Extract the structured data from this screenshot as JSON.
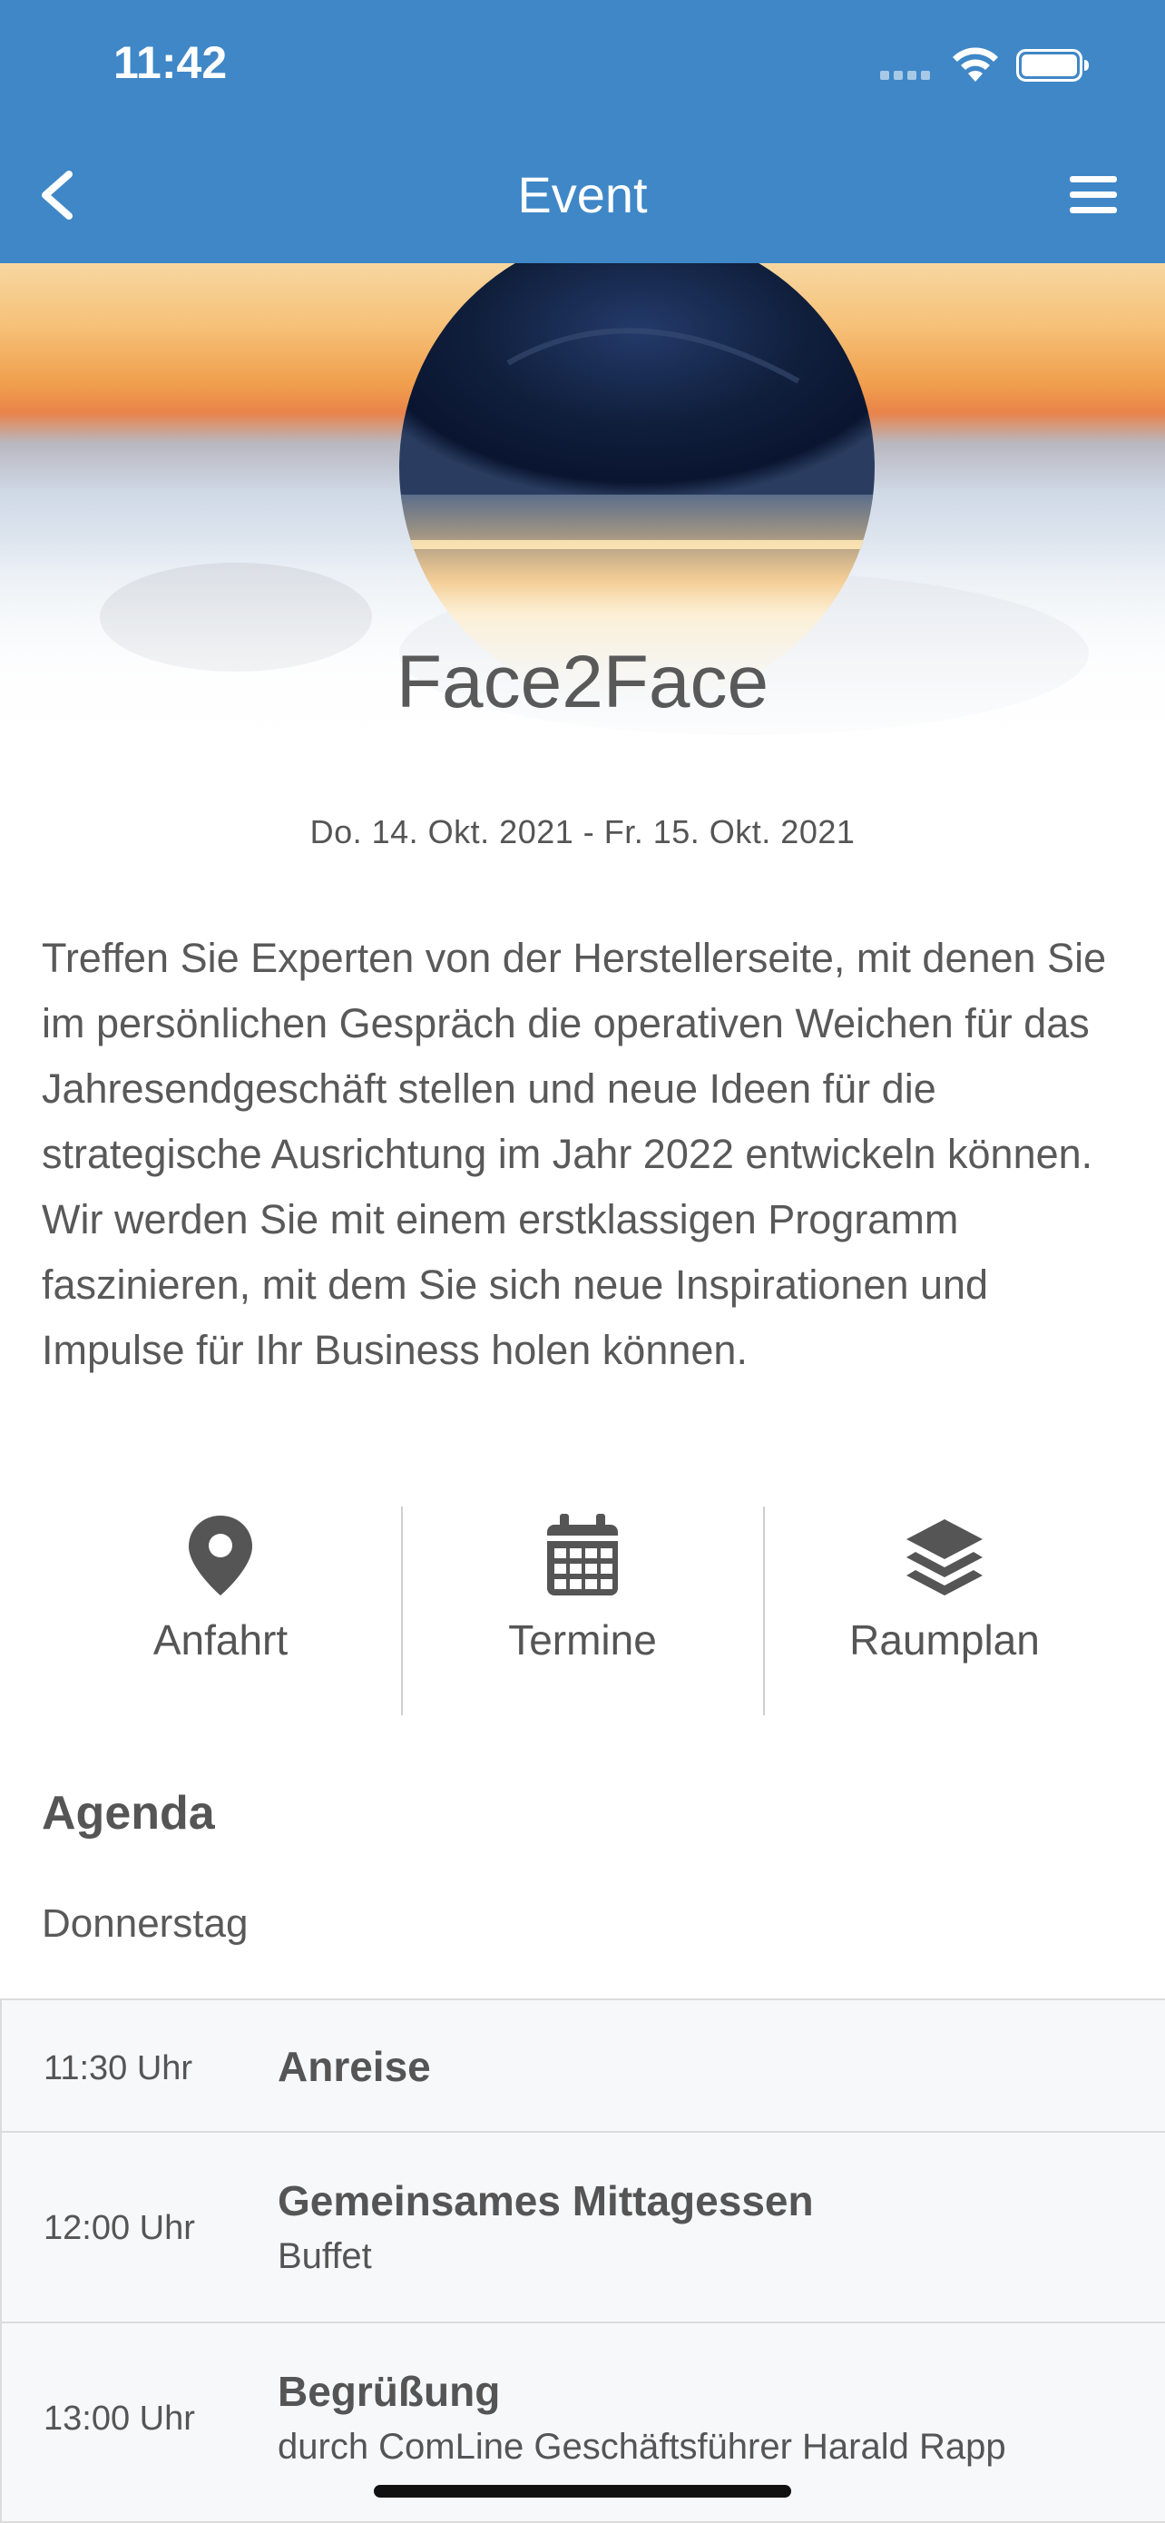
{
  "status_bar": {
    "time": "11:42"
  },
  "nav": {
    "title": "Event",
    "back_icon": "chevron-left-icon",
    "menu_icon": "hamburger-menu-icon"
  },
  "event": {
    "title": "Face2Face",
    "date": "Do. 14. Okt. 2021 - Fr. 15. Okt. 2021",
    "description": "Treffen Sie Experten von der Herstellerseite, mit denen Sie im persönlichen Gespräch die operativen Weichen für das Jahresendgeschäft stellen und neue Ideen für die strategische Ausrichtung im Jahr 2022 entwickeln können. Wir werden Sie mit einem erstklassigen Programm faszinieren, mit dem Sie sich neue Inspirationen und Impulse für Ihr Business holen können."
  },
  "quick_links": [
    {
      "label": "Anfahrt",
      "icon": "map-pin-icon"
    },
    {
      "label": "Termine",
      "icon": "calendar-icon"
    },
    {
      "label": "Raumplan",
      "icon": "layers-icon"
    }
  ],
  "agenda": {
    "heading": "Agenda",
    "day": "Donnerstag",
    "items": [
      {
        "time": "11:30 Uhr",
        "title": "Anreise",
        "subtitle": ""
      },
      {
        "time": "12:00 Uhr",
        "title": "Gemeinsames Mittagessen",
        "subtitle": "Buffet"
      },
      {
        "time": "13:00 Uhr",
        "title": "Begrüßung",
        "subtitle": "durch ComLine Geschäftsführer Harald Rapp"
      }
    ]
  },
  "colors": {
    "header": "#3f87c7",
    "text": "#555555",
    "row_background": "#f7f8fa"
  }
}
